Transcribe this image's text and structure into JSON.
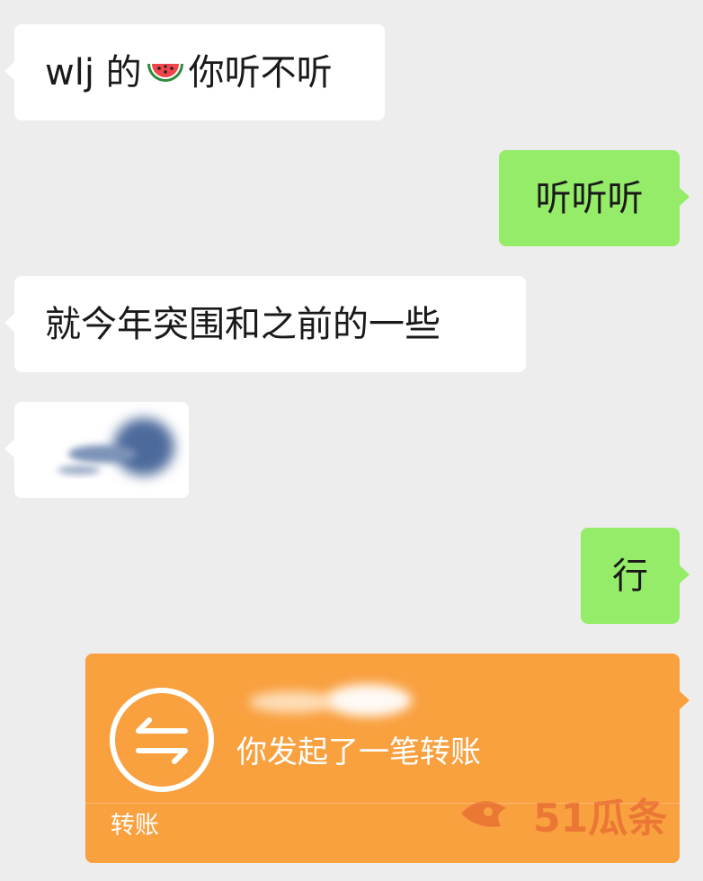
{
  "messages": [
    {
      "id": "msg1",
      "side": "left",
      "text_before": "wlj 的",
      "emoji": "watermelon-emoji",
      "text_after": "你听不听"
    },
    {
      "id": "msg2",
      "side": "right",
      "text": "听听听"
    },
    {
      "id": "msg3",
      "side": "left",
      "text": "就今年突围和之前的一些"
    },
    {
      "id": "msg4",
      "side": "left",
      "content": "blurred-image"
    },
    {
      "id": "msg5",
      "side": "right",
      "text": "行"
    }
  ],
  "transfer": {
    "icon": "transfer-arrows-icon",
    "amount": "",
    "description": "你发起了一笔转账",
    "label": "转账"
  },
  "watermark": {
    "text": "51瓜条"
  },
  "colors": {
    "background": "#ededed",
    "incoming_bubble": "#ffffff",
    "outgoing_bubble": "#95ec69",
    "transfer_card": "#f9a03f"
  }
}
